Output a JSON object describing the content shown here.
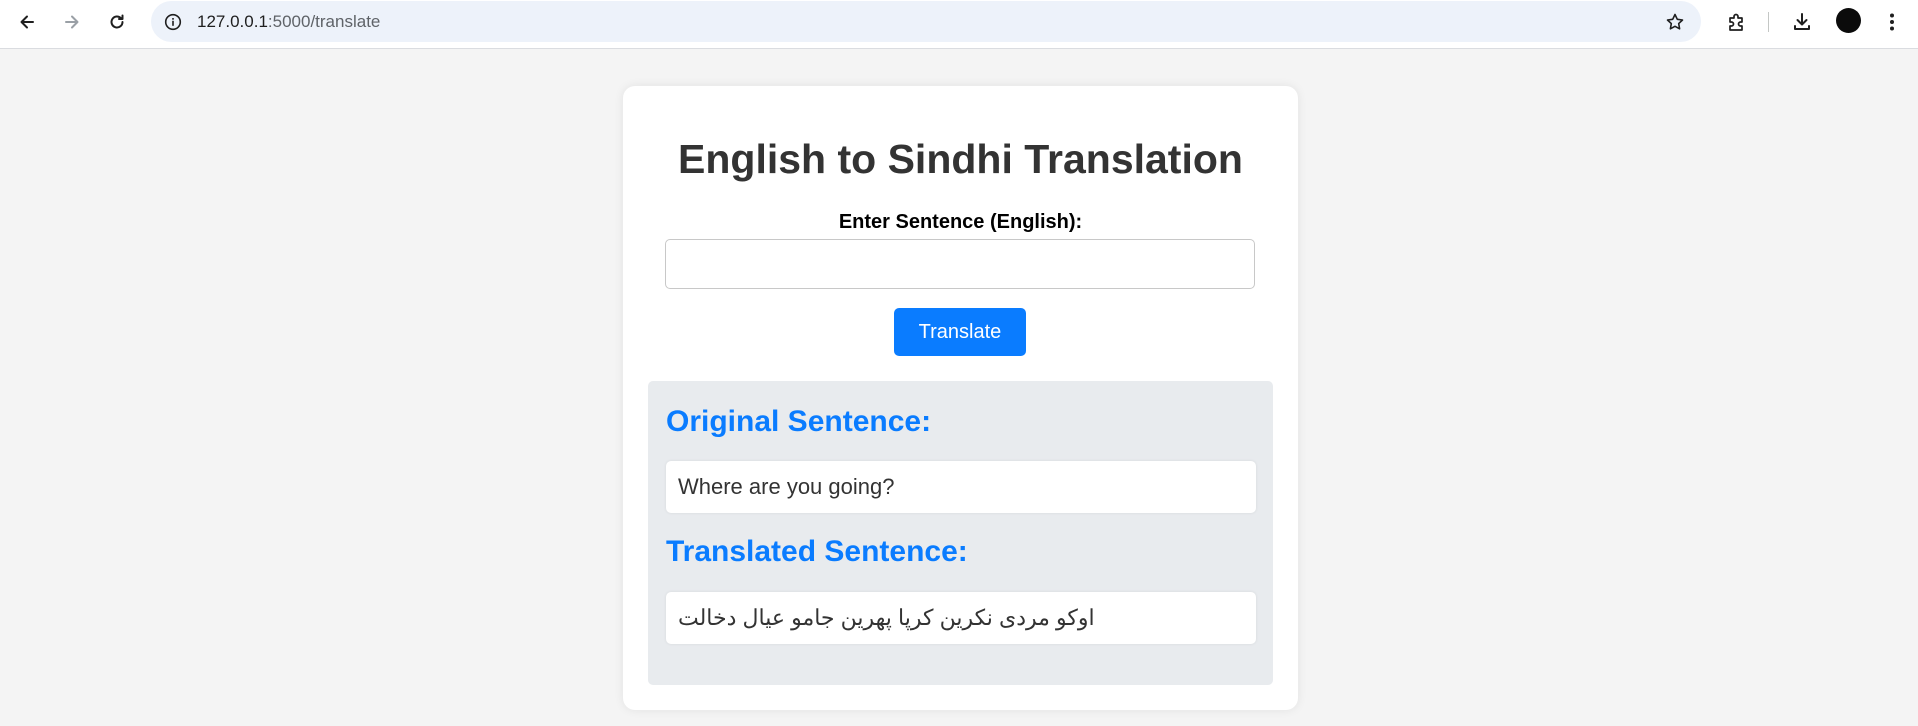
{
  "browser": {
    "url_host": "127.0.0.1",
    "url_rest": ":5000/translate",
    "icons": {
      "back": "back-arrow-icon",
      "forward": "forward-arrow-icon",
      "reload": "reload-icon",
      "site_info": "info-icon",
      "bookmark": "star-icon",
      "extensions": "puzzle-icon",
      "downloads": "download-icon",
      "menu": "kebab-menu-icon"
    }
  },
  "page": {
    "title": "English to Sindhi Translation",
    "input_label": "Enter Sentence (English):",
    "input_value": "",
    "translate_button": "Translate",
    "original_heading": "Original Sentence:",
    "original_text": "Where are you going?",
    "translated_heading": "Translated Sentence:",
    "translated_text": "اوکو مردی نکرین کرپا پهرین جامو عیال دخالت"
  },
  "colors": {
    "accent": "#0a7cff",
    "page_bg": "#f4f4f4",
    "result_bg": "#e8ebee"
  }
}
